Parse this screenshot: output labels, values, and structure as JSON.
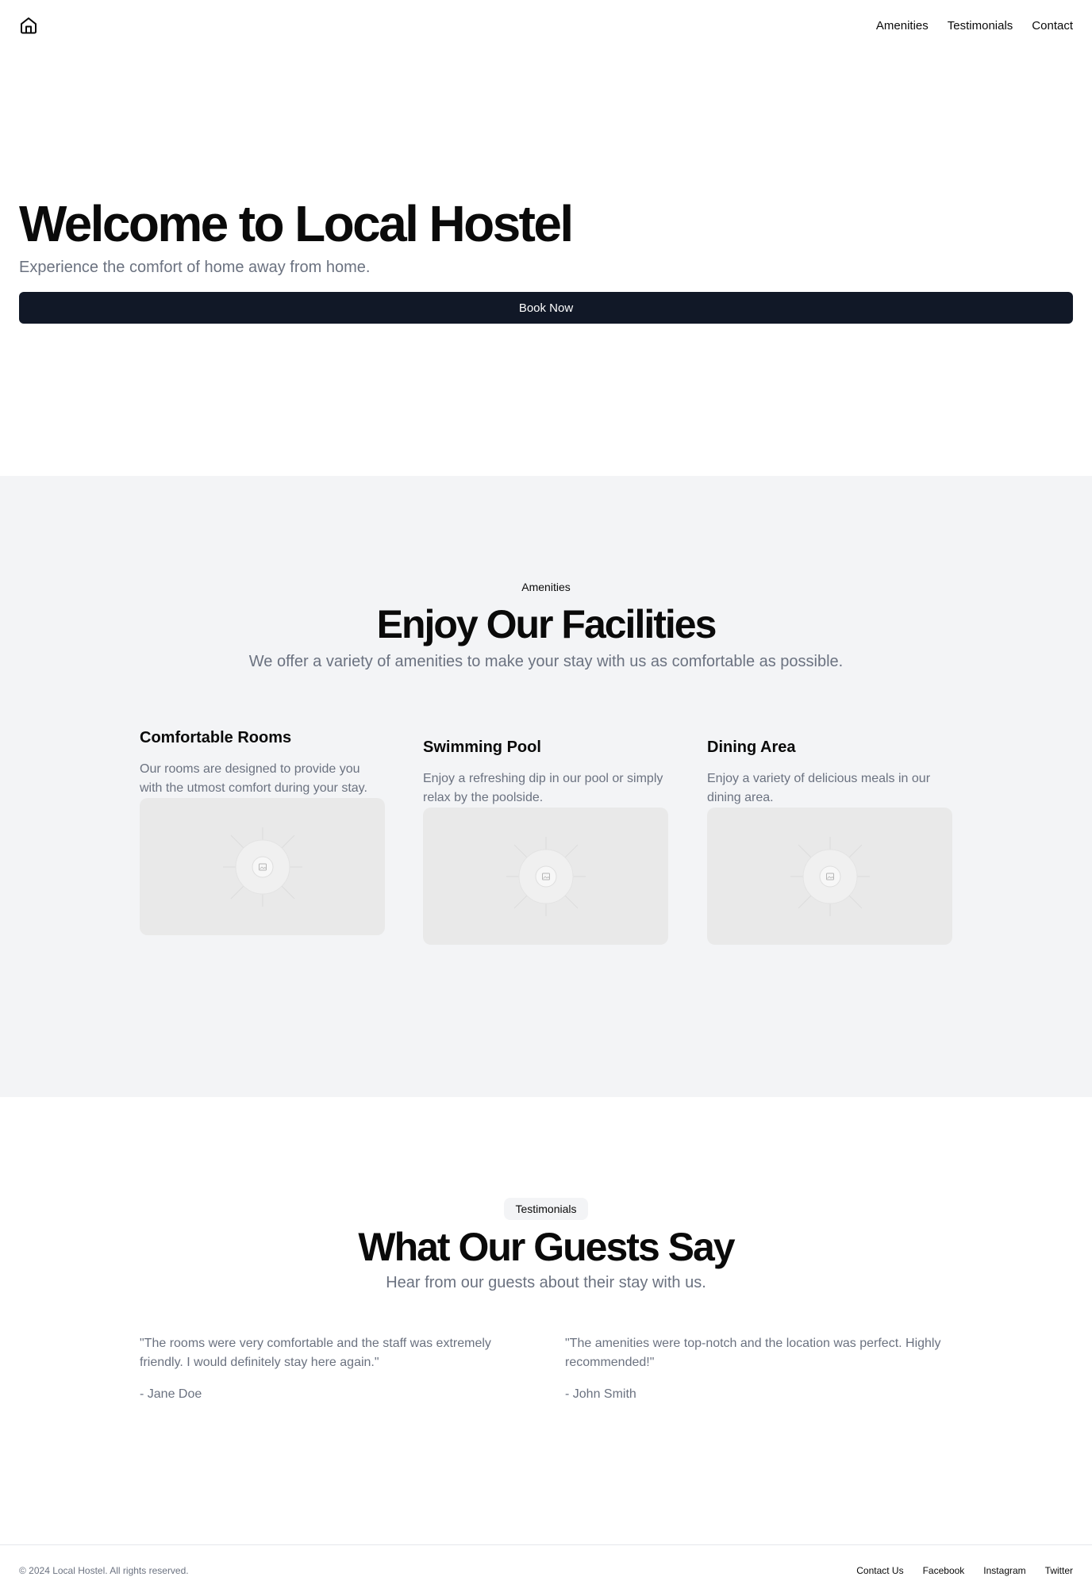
{
  "header": {
    "logo_icon": "home-icon",
    "nav": [
      {
        "label": "Amenities"
      },
      {
        "label": "Testimonials"
      },
      {
        "label": "Contact"
      }
    ]
  },
  "hero": {
    "title": "Welcome to Local Hostel",
    "subtitle": "Experience the comfort of home away from home.",
    "cta_label": "Book Now"
  },
  "amenities": {
    "eyebrow": "Amenities",
    "title": "Enjoy Our Facilities",
    "subtitle": "We offer a variety of amenities to make your stay with us as comfortable as possible.",
    "items": [
      {
        "title": "Comfortable Rooms",
        "description": "Our rooms are designed to provide you with the utmost comfort during your stay.",
        "image_icon": "image-placeholder-icon"
      },
      {
        "title": "Swimming Pool",
        "description": "Enjoy a refreshing dip in our pool or simply relax by the poolside.",
        "image_icon": "image-placeholder-icon"
      },
      {
        "title": "Dining Area",
        "description": "Enjoy a variety of delicious meals in our dining area.",
        "image_icon": "image-placeholder-icon"
      }
    ]
  },
  "testimonials": {
    "badge": "Testimonials",
    "title": "What Our Guests Say",
    "subtitle": "Hear from our guests about their stay with us.",
    "items": [
      {
        "quote": "\"The rooms were very comfortable and the staff was extremely friendly. I would definitely stay here again.\"",
        "author": "- Jane Doe"
      },
      {
        "quote": "\"The amenities were top-notch and the location was perfect. Highly recommended!\"",
        "author": "- John Smith"
      }
    ]
  },
  "footer": {
    "copyright": "© 2024 Local Hostel. All rights reserved.",
    "links": [
      {
        "label": "Contact Us"
      },
      {
        "label": "Facebook"
      },
      {
        "label": "Instagram"
      },
      {
        "label": "Twitter"
      }
    ]
  },
  "colors": {
    "primary_button": "#111827",
    "section_bg": "#f3f4f6",
    "muted_text": "#6b7280",
    "image_placeholder": "#e9e9e9"
  }
}
